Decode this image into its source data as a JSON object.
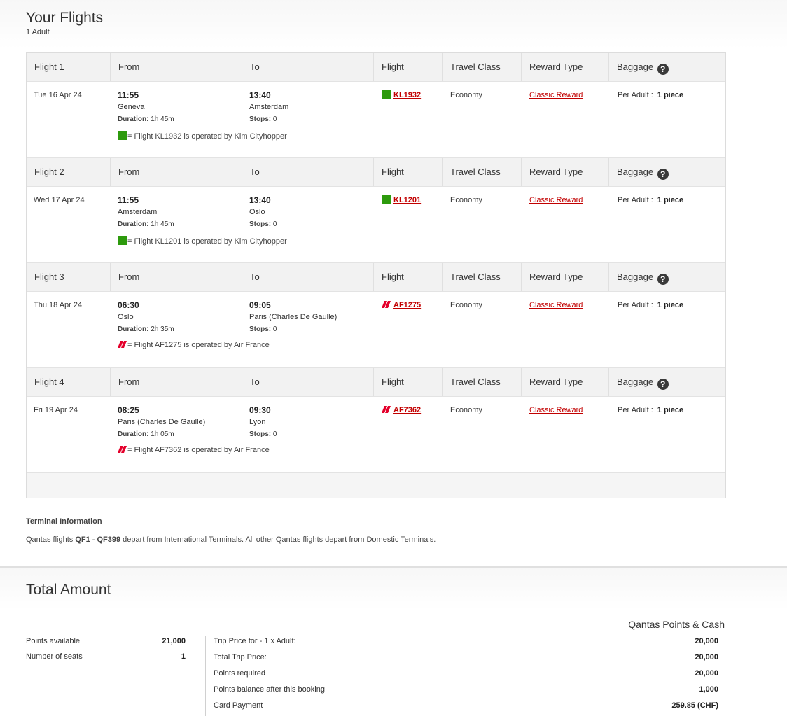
{
  "header": {
    "title": "Your Flights",
    "subtitle": "1 Adult"
  },
  "columns": {
    "from": "From",
    "to": "To",
    "flight": "Flight",
    "travel_class": "Travel Class",
    "reward_type": "Reward Type",
    "baggage": "Baggage"
  },
  "labels": {
    "duration": "Duration:",
    "stops": "Stops:",
    "per_adult": "Per Adult :"
  },
  "flights": [
    {
      "label": "Flight 1",
      "date": "Tue 16 Apr 24",
      "dep_time": "11:55",
      "dep_city": "Geneva",
      "duration": "1h 45m",
      "arr_time": "13:40",
      "arr_city": "Amsterdam",
      "stops": "0",
      "flight_no": "KL1932",
      "airline_logo": "klm-green-square-icon",
      "class": "Economy",
      "reward": "Classic Reward",
      "baggage": "1 piece",
      "operated": "= Flight KL1932 is operated by Klm Cityhopper"
    },
    {
      "label": "Flight 2",
      "date": "Wed 17 Apr 24",
      "dep_time": "11:55",
      "dep_city": "Amsterdam",
      "duration": "1h 45m",
      "arr_time": "13:40",
      "arr_city": "Oslo",
      "stops": "0",
      "flight_no": "KL1201",
      "airline_logo": "klm-green-square-icon",
      "class": "Economy",
      "reward": "Classic Reward",
      "baggage": "1 piece",
      "operated": "= Flight KL1201 is operated by Klm Cityhopper"
    },
    {
      "label": "Flight 3",
      "date": "Thu 18 Apr 24",
      "dep_time": "06:30",
      "dep_city": "Oslo",
      "duration": "2h 35m",
      "arr_time": "09:05",
      "arr_city": "Paris (Charles De Gaulle)",
      "stops": "0",
      "flight_no": "AF1275",
      "airline_logo": "air-france-stripe-icon",
      "class": "Economy",
      "reward": "Classic Reward",
      "baggage": "1 piece",
      "operated": "= Flight AF1275 is operated by Air France"
    },
    {
      "label": "Flight 4",
      "date": "Fri 19 Apr 24",
      "dep_time": "08:25",
      "dep_city": "Paris (Charles De Gaulle)",
      "duration": "1h 05m",
      "arr_time": "09:30",
      "arr_city": "Lyon",
      "stops": "0",
      "flight_no": "AF7362",
      "airline_logo": "air-france-stripe-icon",
      "class": "Economy",
      "reward": "Classic Reward",
      "baggage": "1 piece",
      "operated": "= Flight AF7362 is operated by Air France"
    }
  ],
  "terminal": {
    "title": "Terminal Information",
    "text_prefix": "Qantas flights ",
    "text_bold": "QF1 - QF399",
    "text_suffix": " depart from International Terminals. All other Qantas flights depart from Domestic Terminals."
  },
  "total": {
    "title": "Total Amount",
    "column_title": "Qantas Points & Cash",
    "points_available_label": "Points available",
    "points_available": "21,000",
    "seats_label": "Number of seats",
    "seats": "1",
    "rows": [
      {
        "label": "Trip Price for - 1 x Adult:",
        "value": "20,000"
      },
      {
        "label": "Total Trip Price:",
        "value": "20,000"
      },
      {
        "label": "Points required",
        "value": "20,000"
      },
      {
        "label": "Points balance after this booking",
        "value": "1,000"
      },
      {
        "label": "Card Payment",
        "value": "259.85 (CHF)"
      }
    ]
  },
  "colors": {
    "klm_green": "#2d9a0d",
    "af_red": "#e4002b",
    "link_red": "#c20000"
  }
}
